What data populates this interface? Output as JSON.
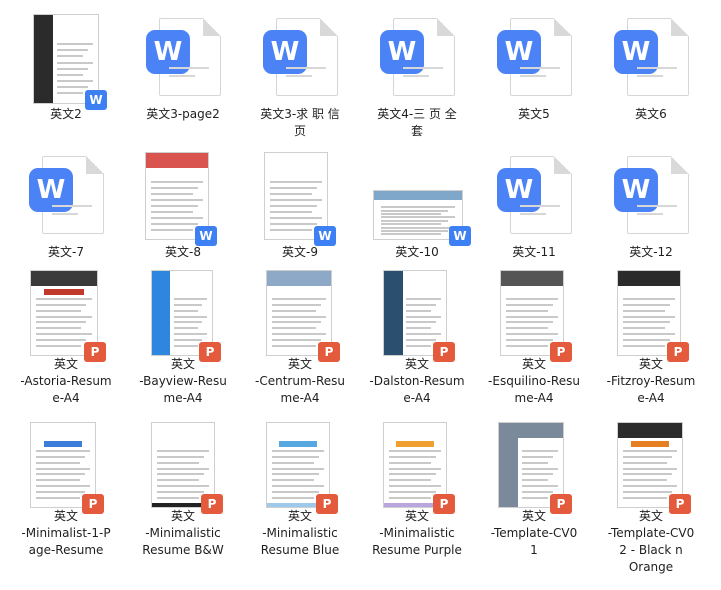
{
  "files": [
    {
      "id": "f1",
      "lines": [
        "英文2"
      ],
      "kind": "preview-w",
      "style": "dark-side"
    },
    {
      "id": "f2",
      "lines": [
        "英文3-page2"
      ],
      "kind": "word"
    },
    {
      "id": "f3",
      "lines": [
        "英文3-求 职 信",
        "页"
      ],
      "kind": "word"
    },
    {
      "id": "f4",
      "lines": [
        "英文4-三 页 全",
        "套"
      ],
      "kind": "word"
    },
    {
      "id": "f5",
      "lines": [
        "英文5"
      ],
      "kind": "word"
    },
    {
      "id": "f6",
      "lines": [
        "英文6"
      ],
      "kind": "word"
    },
    {
      "id": "f7",
      "lines": [
        "英文-7"
      ],
      "kind": "word"
    },
    {
      "id": "f8",
      "lines": [
        "英文-8"
      ],
      "kind": "preview-w",
      "style": "red-top"
    },
    {
      "id": "f9",
      "lines": [
        "英文-9"
      ],
      "kind": "preview-w",
      "style": "plain"
    },
    {
      "id": "f10",
      "lines": [
        "英文-10"
      ],
      "kind": "preview-w",
      "style": "landscape"
    },
    {
      "id": "f11",
      "lines": [
        "英文-11"
      ],
      "kind": "word"
    },
    {
      "id": "f12",
      "lines": [
        "英文-12"
      ],
      "kind": "word"
    },
    {
      "id": "f13",
      "lines": [
        "英文",
        "-Astoria-Resum",
        "e-A4"
      ],
      "kind": "preview-p",
      "style": "astoria"
    },
    {
      "id": "f14",
      "lines": [
        "英文",
        "-Bayview-Resu",
        "me-A4"
      ],
      "kind": "preview-p",
      "style": "bayview"
    },
    {
      "id": "f15",
      "lines": [
        "英文",
        "-Centrum-Resu",
        "me-A4"
      ],
      "kind": "preview-p",
      "style": "centrum"
    },
    {
      "id": "f16",
      "lines": [
        "英文",
        "-Dalston-Resum",
        "e-A4"
      ],
      "kind": "preview-p",
      "style": "dalston"
    },
    {
      "id": "f17",
      "lines": [
        "英文",
        "-Esquilino-Resu",
        "me-A4"
      ],
      "kind": "preview-p",
      "style": "esquilino"
    },
    {
      "id": "f18",
      "lines": [
        "英文",
        "-Fitzroy-Resum",
        "e-A4"
      ],
      "kind": "preview-p",
      "style": "fitzroy"
    },
    {
      "id": "f19",
      "lines": [
        "英文",
        "-Minimalist-1-P",
        "age-Resume"
      ],
      "kind": "preview-p",
      "style": "minimal1"
    },
    {
      "id": "f20",
      "lines": [
        "英文",
        "-Minimalistic",
        "Resume B&W"
      ],
      "kind": "preview-p",
      "style": "bw"
    },
    {
      "id": "f21",
      "lines": [
        "英文",
        "-Minimalistic",
        "Resume Blue"
      ],
      "kind": "preview-p",
      "style": "blue"
    },
    {
      "id": "f22",
      "lines": [
        "英文",
        "-Minimalistic",
        "Resume Purple"
      ],
      "kind": "preview-p",
      "style": "purple"
    },
    {
      "id": "f23",
      "lines": [
        "英文",
        "-Template-CV0",
        "1"
      ],
      "kind": "preview-p",
      "style": "cv01"
    },
    {
      "id": "f24",
      "lines": [
        "英文",
        "-Template-CV0",
        "2 - Black n",
        "Orange"
      ],
      "kind": "preview-p",
      "style": "cv02"
    }
  ],
  "colors": {
    "word_badge": "#3d80f3",
    "ppt_badge": "#e35a3c",
    "word_icon": "#4b83f6"
  },
  "badge_text": {
    "word": "W",
    "ppt": "P"
  }
}
